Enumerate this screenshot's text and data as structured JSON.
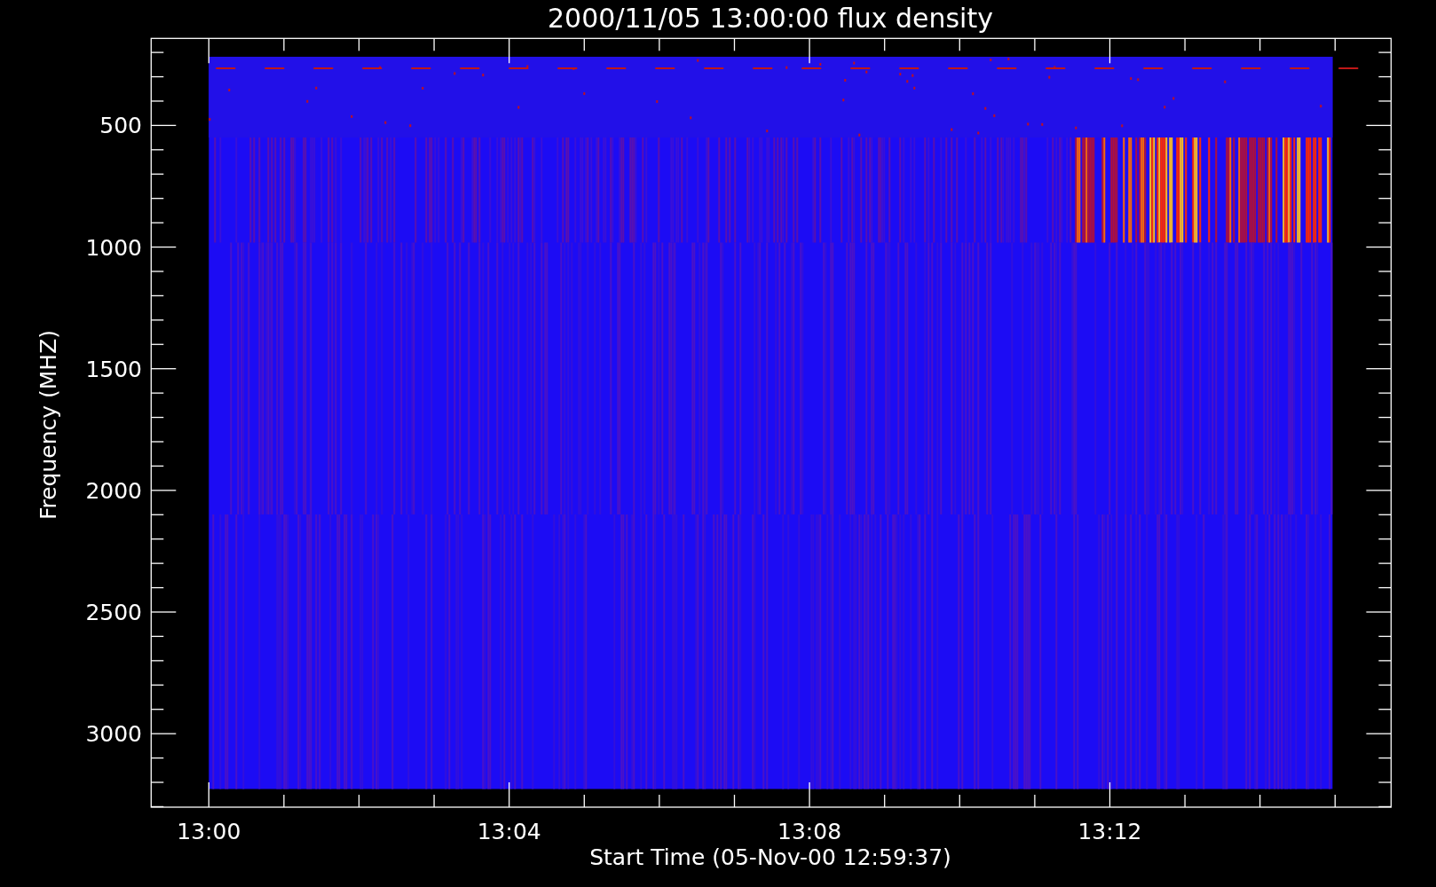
{
  "plot": {
    "title": "2000/11/05 13:00:00 flux density",
    "ylabel": "Frequency (MHZ)",
    "xlabel": "Start Time (05-Nov-00 12:59:37)",
    "y_tick_labels": [
      "500",
      "1000",
      "1500",
      "2000",
      "2500",
      "3000"
    ],
    "x_tick_labels": [
      "13:00",
      "13:04",
      "13:08",
      "13:12"
    ]
  }
}
